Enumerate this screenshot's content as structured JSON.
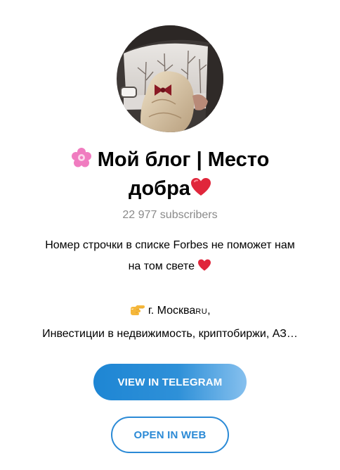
{
  "channel": {
    "title_emoji_left": "cherry-blossom-icon",
    "title_line1": "Мой блог | Место",
    "title_line2": "добра",
    "title_emoji_right": "red-heart-icon",
    "subscribers": "22 977 subscribers",
    "description": {
      "line1": "Номер строчки в списке Forbes не поможет нам",
      "line2": "на том свете",
      "location_prefix": "г. Москва",
      "location_flag": "RU",
      "location_suffix": ",",
      "line4": "Инвестиции в недвижимость, криптобиржи, АЗ…"
    }
  },
  "buttons": {
    "view_in_telegram": "VIEW IN TELEGRAM",
    "open_in_web": "OPEN IN WEB"
  },
  "colors": {
    "accent": "#2b8ad6",
    "subscribers_text": "#8a8a8a",
    "heart": "#e0263b",
    "blossom": "#f07cc0"
  }
}
